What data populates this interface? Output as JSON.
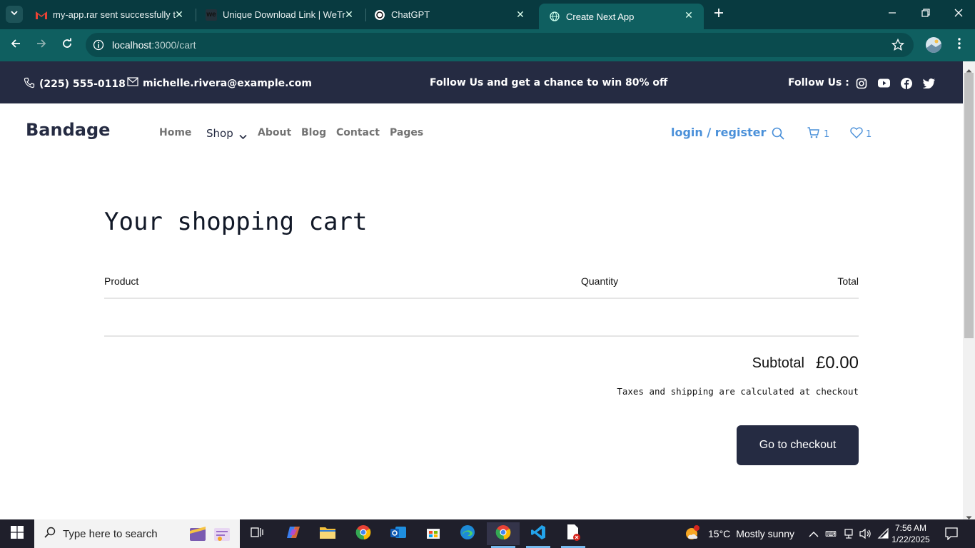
{
  "browser": {
    "tabs": [
      {
        "title": "my-app.rar sent successfully to",
        "favicon": "gmail-icon"
      },
      {
        "title": "Unique Download Link | WeTransfer",
        "favicon": "wetransfer-icon"
      },
      {
        "title": "ChatGPT",
        "favicon": "chatgpt-icon"
      },
      {
        "title": "Create Next App",
        "favicon": "globe-icon",
        "active": true
      }
    ],
    "url_host": "localhost",
    "url_path": ":3000/cart"
  },
  "topbar": {
    "phone": "(225) 555-0118",
    "email": "michelle.rivera@example.com",
    "promo": "Follow Us and get a chance to win 80% off",
    "follow_label": "Follow Us :"
  },
  "header": {
    "brand": "Bandage",
    "nav": [
      "Home",
      "Shop",
      "About",
      "Blog",
      "Contact",
      "Pages"
    ],
    "login": "login / register",
    "cart_count": "1",
    "wishlist_count": "1"
  },
  "cart": {
    "title": "Your shopping cart",
    "columns": {
      "product": "Product",
      "quantity": "Quantity",
      "total": "Total"
    },
    "subtotal_label": "Subtotal",
    "subtotal_value": "£0.00",
    "taxes_note": "Taxes and shipping are calculated at checkout",
    "checkout_label": "Go to checkout"
  },
  "taskbar": {
    "search_placeholder": "Type here to search",
    "weather_temp": "15°C",
    "weather_desc": "Mostly sunny",
    "time": "7:56 AM",
    "date": "1/22/2025"
  },
  "colors": {
    "dark": "#252b42",
    "accent": "#4a90d9",
    "chrome_bg": "#0f5f60"
  }
}
